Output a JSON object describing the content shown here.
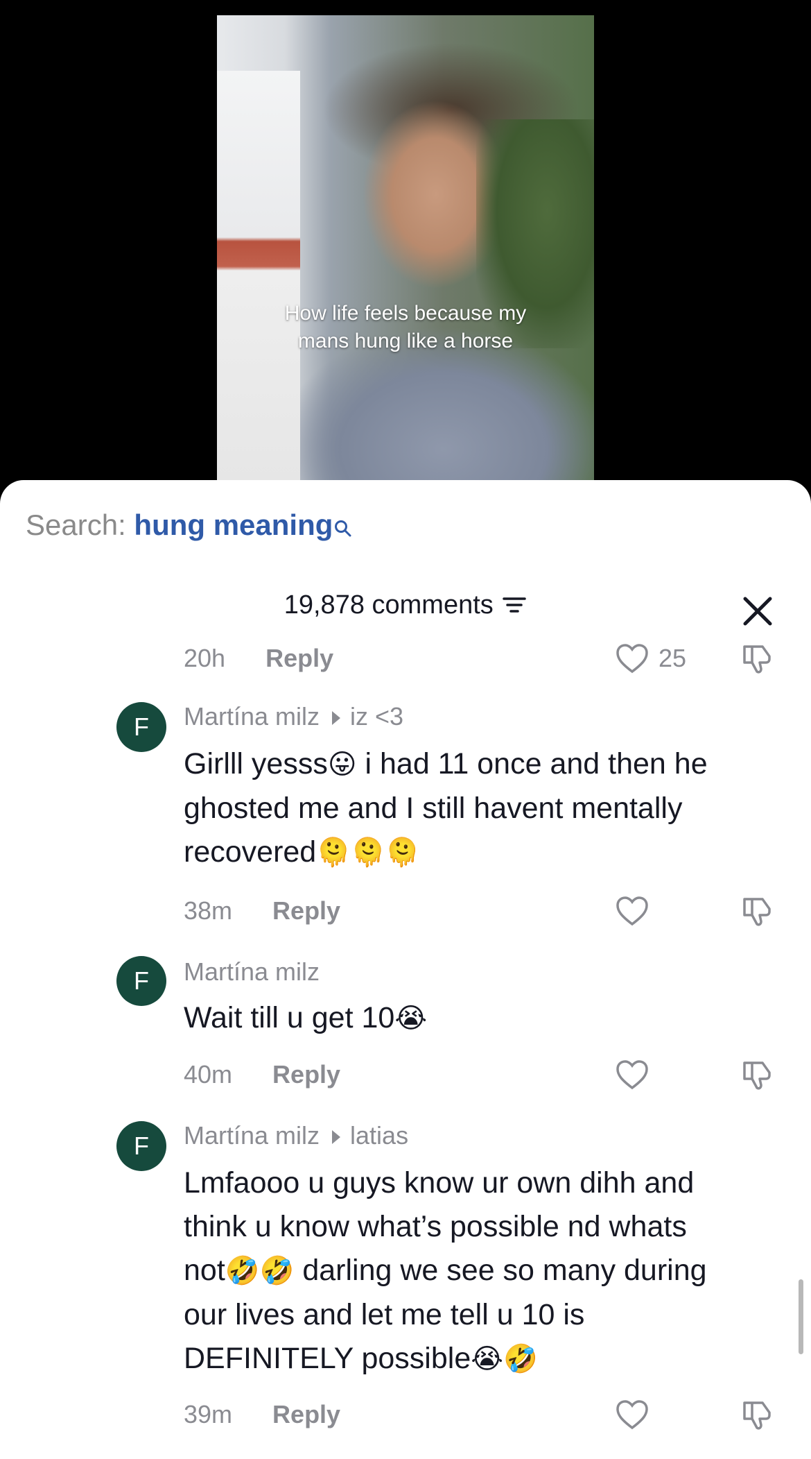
{
  "video": {
    "caption_line1": "How life feels because my",
    "caption_line2": "mans hung like a horse"
  },
  "search": {
    "label": "Search:",
    "query": "hung meaning",
    "icon": "search-icon"
  },
  "comments_header": {
    "count_label": "19,878 comments",
    "sort_icon": "filter-icon",
    "close_icon": "close-icon"
  },
  "comments": [
    {
      "partial": true,
      "time": "20h",
      "reply_label": "Reply",
      "likes": "25"
    },
    {
      "avatar": "F",
      "author": "Martína milz",
      "reply_to": "iz <3",
      "line1": "Girlll yesss",
      "emoji1": "😛",
      "line1b": " i had 11 once and then he",
      "line2": "ghosted me and I still havent mentally",
      "line3": "recovered",
      "emoji3": "🫠🫠🫠",
      "time": "38m",
      "reply_label": "Reply"
    },
    {
      "avatar": "F",
      "author": "Martína milz",
      "line1": "Wait till u get 10",
      "emoji1": "😭",
      "time": "40m",
      "reply_label": "Reply"
    },
    {
      "avatar": "F",
      "author": "Martína milz",
      "reply_to": "latias",
      "line1": "Lmfaooo u guys know ur own dihh and",
      "line2": "think u know what’s possible nd whats",
      "line3a": "not",
      "emoji3": "🤣🤣",
      "line3b": " darling we see so many during",
      "line4": "our lives and let me tell u 10 is",
      "line5": "DEFINITELY possible",
      "emoji5": "😭🤣",
      "time": "39m",
      "reply_label": "Reply"
    }
  ],
  "colors": {
    "accent_link": "#2f5aa8",
    "avatar_bg": "#164a3d",
    "meta_text": "#8a8b91",
    "body_text": "#161823"
  }
}
